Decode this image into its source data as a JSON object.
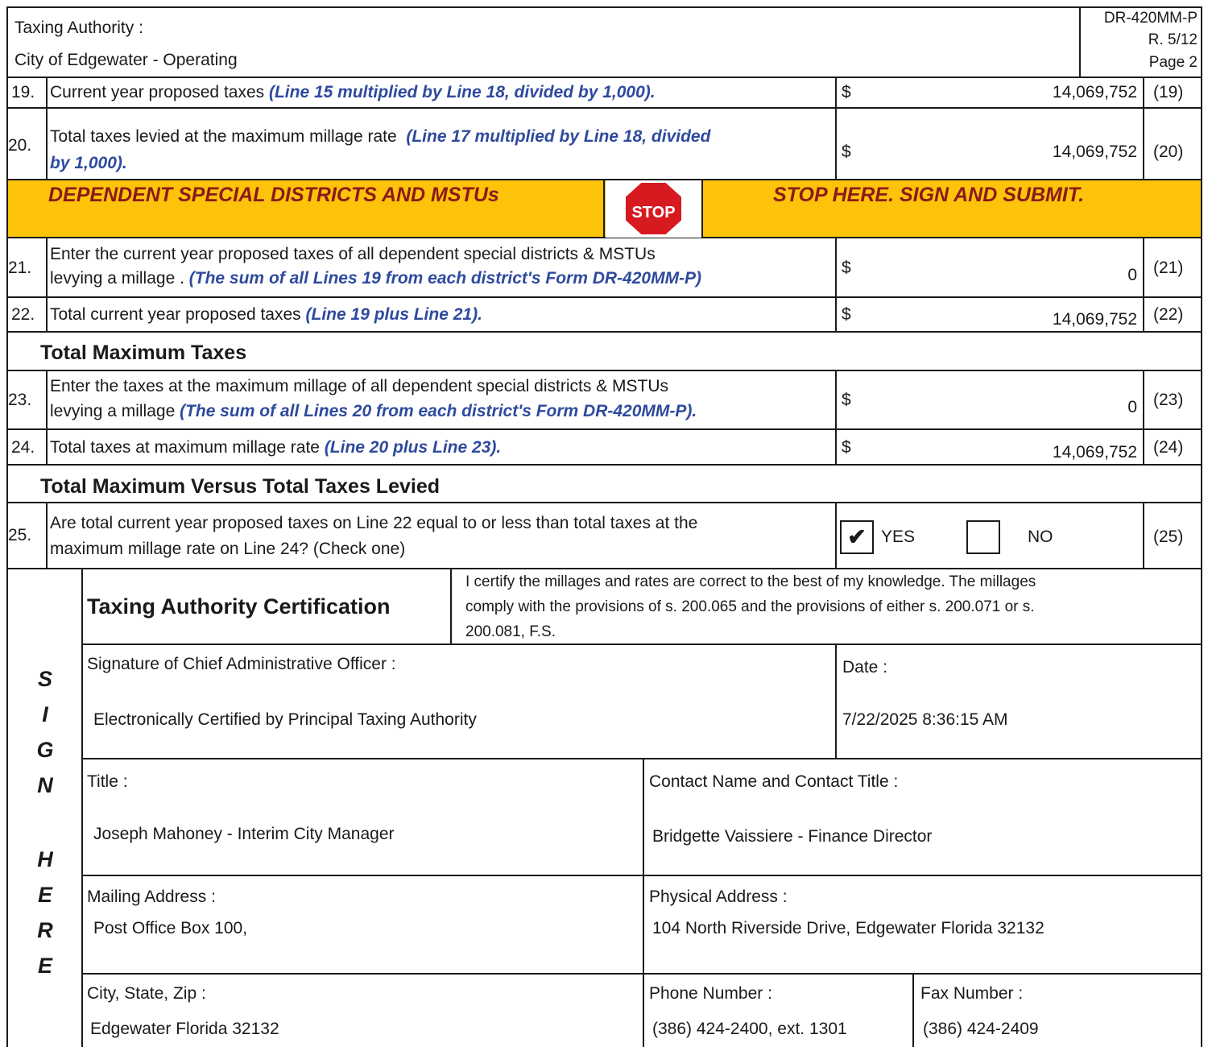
{
  "header": {
    "taxing_authority_label": "Taxing Authority :",
    "taxing_authority": "City of Edgewater - Operating",
    "form_id": "DR-420MM-P",
    "revision": "R. 5/12",
    "page": "Page 2"
  },
  "rows": {
    "r19": {
      "num": "19.",
      "text": "Current year proposed taxes",
      "note": "(Line 15 multiplied by Line 18, divided by 1,000).",
      "currency": "$",
      "value": "14,069,752",
      "ref": "(19)"
    },
    "r20": {
      "num": "20.",
      "text": "Total taxes levied at the maximum millage rate",
      "note1": "(Line 17 multiplied by Line 18, divided",
      "note2": "by 1,000).",
      "currency": "$",
      "value": "14,069,752",
      "ref": "(20)"
    },
    "r21": {
      "num": "21.",
      "text1": "Enter the current year proposed taxes of all dependent special districts & MSTUs",
      "text2": "levying a millage",
      "note": "(The sum of all Lines 19 from each district's Form DR-420MM-P)",
      "currency": "$",
      "value": "0",
      "ref": "(21)"
    },
    "r22": {
      "num": "22.",
      "text": "Total current year proposed taxes",
      "note": "(Line 19 plus Line 21).",
      "currency": "$",
      "value": "14,069,752",
      "ref": "(22)"
    },
    "r23": {
      "num": "23.",
      "text1": "Enter the taxes at the maximum millage of all dependent special districts & MSTUs",
      "text2": "levying a millage",
      "note": "(The sum of all Lines 20 from each district's Form DR-420MM-P).",
      "currency": "$",
      "value": "0",
      "ref": "(23)"
    },
    "r24": {
      "num": "24.",
      "text": "Total taxes at maximum millage rate",
      "note": "(Line 20 plus Line 23).",
      "currency": "$",
      "value": "14,069,752",
      "ref": "(24)"
    },
    "r25": {
      "num": "25.",
      "text1": "Are total current year proposed taxes on Line 22 equal to or less than total taxes at the",
      "text2": "maximum millage rate on Line 24? (Check one)",
      "yes_label": "YES",
      "no_label": "NO",
      "yes_mark": "✔",
      "ref": "(25)"
    }
  },
  "banner": {
    "left": "DEPENDENT SPECIAL  DISTRICTS AND MSTUs",
    "stop_sign": "STOP",
    "right": "STOP HERE. SIGN AND SUBMIT."
  },
  "sections": {
    "total_max": "Total Maximum Taxes",
    "versus": "Total Maximum Versus Total Taxes Levied"
  },
  "certification": {
    "title": "Taxing Authority Certification",
    "statement1": "I certify the millages and rates are correct to the best of my knowledge. The millages",
    "statement2": "comply with the provisions of s. 200.065 and the provisions of either s. 200.071 or s.",
    "statement3": "200.081, F.S.",
    "sign_letters": [
      "S",
      "I",
      "G",
      "N",
      "H",
      "E",
      "R",
      "E"
    ],
    "signature_label": "Signature of Chief Administrative Officer :",
    "signature_value": "Electronically Certified by Principal Taxing Authority",
    "date_label": "Date  :",
    "date_value": "7/22/2025 8:36:15 AM",
    "title_label": "Title :",
    "title_value": "Joseph Mahoney - Interim City Manager",
    "contact_label": "Contact Name and Contact Title :",
    "contact_value": "Bridgette Vaissiere - Finance Director",
    "mailing_label": "Mailing Address :",
    "mailing_value": "Post Office Box 100,",
    "physical_label": "Physical Address :",
    "physical_value": "104 North Riverside Drive,  Edgewater Florida 32132",
    "city_label": "City, State, Zip :",
    "city_value": "Edgewater Florida 32132",
    "phone_label": "Phone Number :",
    "phone_value": "(386) 424-2400, ext. 1301",
    "fax_label": "Fax Number :",
    "fax_value": "(386) 424-2409"
  }
}
